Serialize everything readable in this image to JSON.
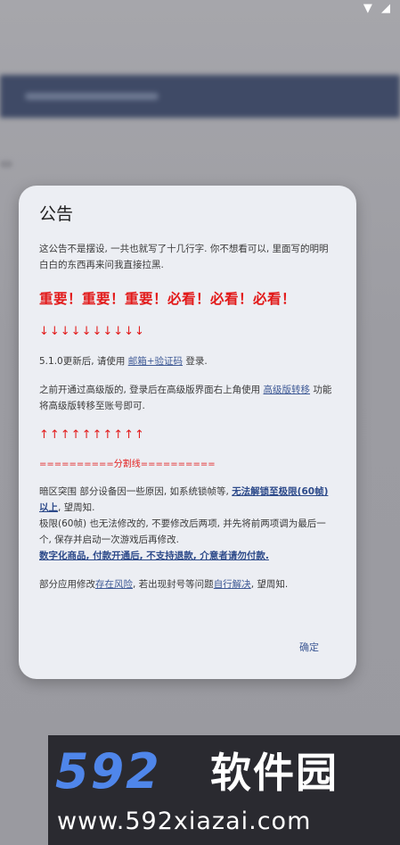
{
  "dialog": {
    "title": "公告",
    "intro": "这公告不是摆设, 一共也就写了十几行字. 你不想看可以, 里面写的明明白白的东西再来问我直接拉黑.",
    "important": "重要！重要！重要！必看！必看！必看！",
    "arrows_down": "↓↓↓↓↓↓↓↓↓↓",
    "update_pre": "5.1.0更新后, 请使用 ",
    "update_link": "邮箱+验证码",
    "update_post": " 登录.",
    "migrate_pre": "之前开通过高级版的, 登录后在高级版界面右上角使用 ",
    "migrate_link": "高级版转移",
    "migrate_post": " 功能将高级版转移至账号即可.",
    "arrows_up": "↑↑↑↑↑↑↑↑↑↑",
    "divider": "==========分割线==========",
    "crash_pre": "暗区突围 部分设备因一些原因, 如系统锁帧等, ",
    "crash_link": "无法解锁至极限(60帧)以上",
    "crash_post": ", 望周知.",
    "limit_text": "极限(60帧) 也无法修改的, 不要修改后两项, 并先将前两项调为最后一个, 保存并启动一次游戏后再修改.",
    "digital_notice": "数字化商品, 付款开通后, 不支持退款, 介意者请勿付款.",
    "risk_pre": "部分应用修改",
    "risk_link": "存在风险",
    "risk_mid": ", 若出现封号等问题",
    "risk_link2": "自行解决",
    "risk_post": ", 望周知.",
    "confirm_label": "确定"
  },
  "watermark": {
    "logo": "592",
    "brand": "软件园",
    "url": "www.592xiazai.com"
  },
  "status": {
    "icons": "▼ ◢"
  }
}
